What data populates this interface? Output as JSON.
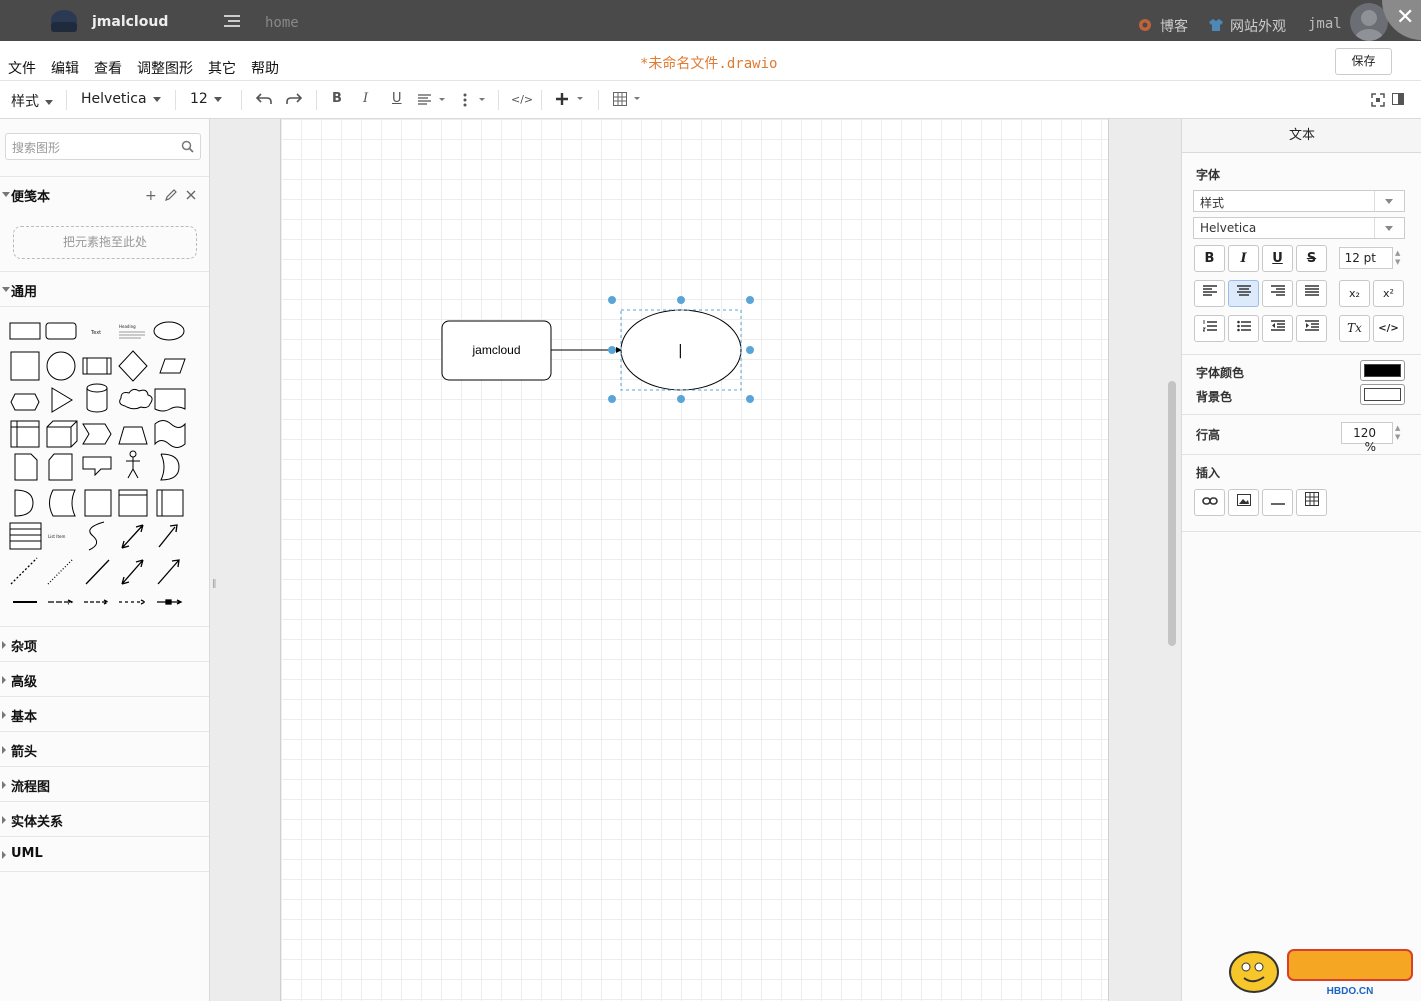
{
  "topbar": {
    "brand": "jmalcloud",
    "nav_text": "home",
    "links": [
      "博客",
      "网站外观",
      "jmal"
    ]
  },
  "menubar": {
    "items": [
      "文件",
      "编辑",
      "查看",
      "调整图形",
      "其它",
      "帮助"
    ],
    "file_title": "*未命名文件.drawio",
    "save_label": "保存"
  },
  "toolbar": {
    "style_label": "样式",
    "font_label": "Helvetica",
    "size_label": "12",
    "bold": "B",
    "italic": "I",
    "underline": "U",
    "code": "</>"
  },
  "sidebar": {
    "search_placeholder": "搜索图形",
    "scratchpad": "便笺本",
    "dropzone": "把元素拖至此处",
    "general": "通用",
    "collapsed_sections": [
      "杂项",
      "高级",
      "基本",
      "箭头",
      "流程图",
      "实体关系",
      "UML"
    ],
    "shape_texts": [
      "Text",
      "Heading",
      "List Item"
    ]
  },
  "canvas": {
    "node_label": "jamcloud",
    "cursor": "|"
  },
  "panel": {
    "tab": "文本",
    "font_heading": "字体",
    "style_value": "样式",
    "font_value": "Helvetica",
    "bold": "B",
    "italic": "I",
    "underline": "U",
    "strike": "S",
    "size_value": "12 pt",
    "font_color_label": "字体颜色",
    "bg_color_label": "背景色",
    "line_height_label": "行高",
    "line_height_value": "120 %",
    "insert_label": "插入",
    "subscript": "x₂",
    "superscript": "x²",
    "clear": "Tx",
    "html": "</>"
  },
  "colors": {
    "accent": "#e07a30",
    "selection": "#5ba4d8",
    "font_color": "#000000",
    "background_color": "#ffffff"
  },
  "watermark": {
    "text": "HBDO.CN"
  }
}
